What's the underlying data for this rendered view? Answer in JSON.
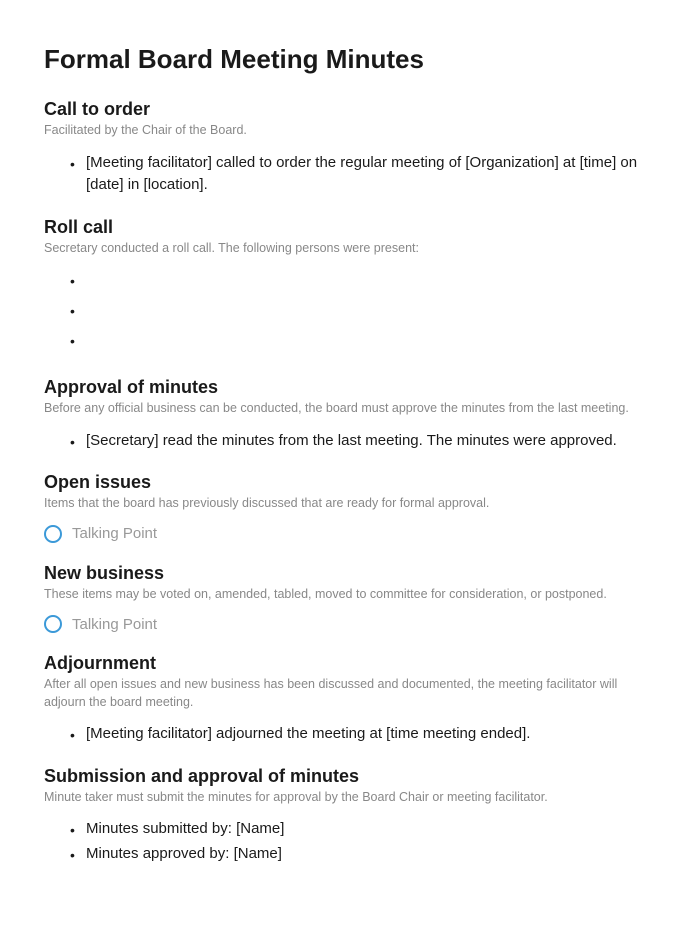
{
  "title": "Formal Board Meeting Minutes",
  "sections": {
    "callToOrder": {
      "heading": "Call to order",
      "subtitle": "Facilitated by the Chair of the Board.",
      "items": [
        "[Meeting facilitator] called to order the regular meeting of [Organization] at [time] on [date] in [location]."
      ]
    },
    "rollCall": {
      "heading": "Roll call",
      "subtitle": "Secretary conducted a roll call. The following persons were present:",
      "items": [
        "",
        "",
        ""
      ]
    },
    "approvalOfMinutes": {
      "heading": "Approval of minutes",
      "subtitle": "Before any official business can be conducted, the board must approve the minutes from the last meeting.",
      "items": [
        "[Secretary] read the minutes from the last meeting. The minutes were approved."
      ]
    },
    "openIssues": {
      "heading": "Open issues",
      "subtitle": "Items that the board has previously discussed that are ready for formal approval.",
      "talkingPoint": "Talking Point"
    },
    "newBusiness": {
      "heading": "New business",
      "subtitle": "These items may be voted on, amended, tabled, moved to committee for consideration, or postponed.",
      "talkingPoint": "Talking Point"
    },
    "adjournment": {
      "heading": "Adjournment",
      "subtitle": "After all open issues and new business has been discussed and documented, the meeting facilitator will adjourn the board meeting.",
      "items": [
        "[Meeting facilitator] adjourned the meeting at [time meeting ended]."
      ]
    },
    "submission": {
      "heading": "Submission and approval of minutes",
      "subtitle": "Minute taker must submit the minutes for approval by the Board Chair or meeting facilitator.",
      "items": [
        "Minutes submitted by: [Name]",
        "Minutes approved by: [Name]"
      ]
    }
  }
}
